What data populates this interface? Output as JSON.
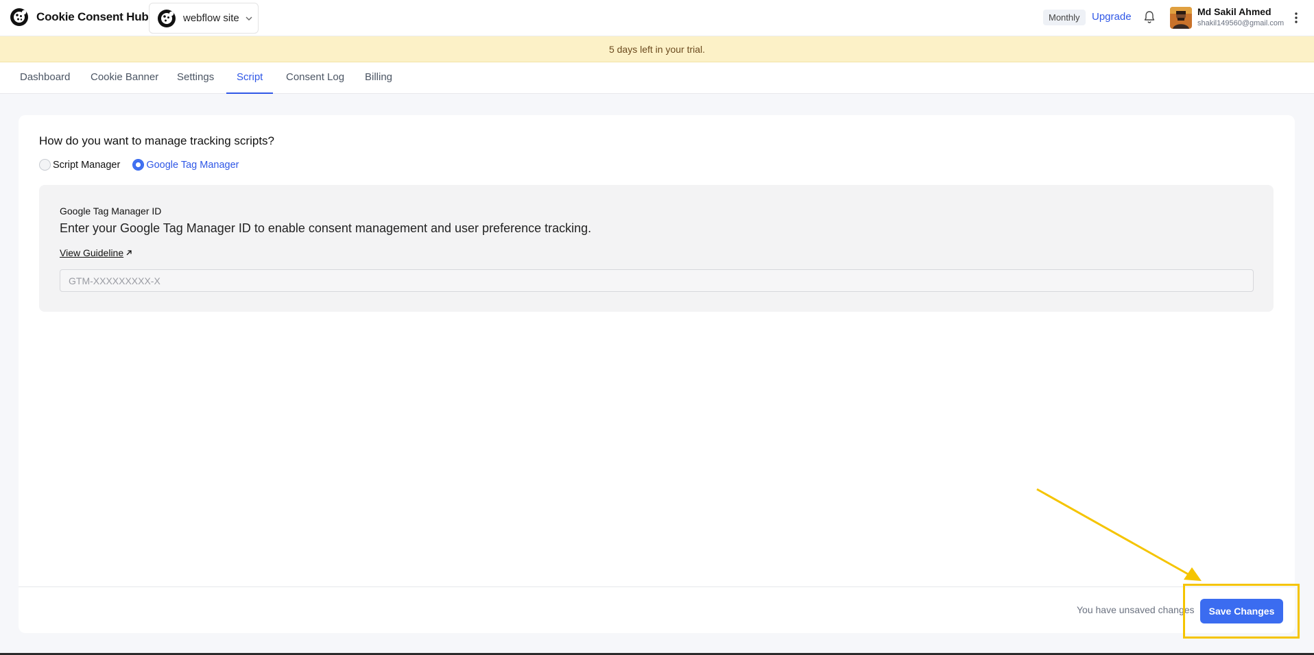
{
  "app": {
    "brand_name": "Cookie Consent Hub",
    "site_selector": {
      "value": "webflow site"
    }
  },
  "header": {
    "plan_badge": "Monthly",
    "upgrade_label": "Upgrade",
    "user": {
      "name": "Md Sakil Ahmed",
      "email": "shakil149560@gmail.com"
    }
  },
  "trial_banner": "5 days left in your trial.",
  "tabs": [
    {
      "label": "Dashboard",
      "active": false
    },
    {
      "label": "Cookie Banner",
      "active": false
    },
    {
      "label": "Settings",
      "active": false
    },
    {
      "label": "Script",
      "active": true
    },
    {
      "label": "Consent Log",
      "active": false
    },
    {
      "label": "Billing",
      "active": false
    }
  ],
  "script_page": {
    "question": "How do you want to manage tracking scripts?",
    "options": [
      {
        "label": "Script Manager",
        "selected": false
      },
      {
        "label": "Google Tag Manager",
        "selected": true
      }
    ],
    "gtm": {
      "title": "Google Tag Manager ID",
      "description": "Enter your Google Tag Manager ID to enable consent management and user preference tracking.",
      "guide_link": "View Guideline",
      "input_value": "",
      "input_placeholder": "GTM-XXXXXXXXX-X"
    }
  },
  "footer": {
    "unsaved_text": "You have unsaved changes",
    "save_label": "Save Changes"
  },
  "colors": {
    "accent": "#3b6cf0",
    "link": "#2f57e6",
    "banner_bg": "#fcf1c7",
    "annotation": "#f5c400"
  }
}
